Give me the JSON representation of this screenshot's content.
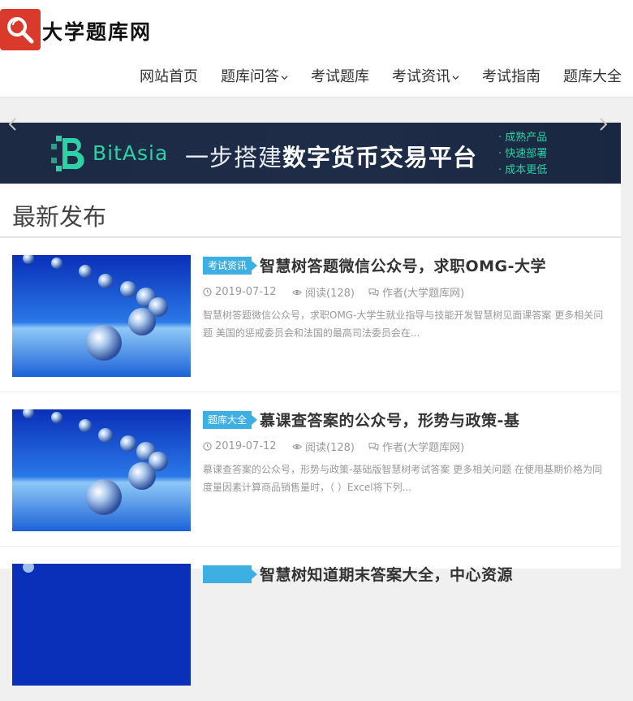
{
  "site": {
    "logo_text": "大学题库网"
  },
  "nav": {
    "items": [
      {
        "label": "网站首页",
        "has_dropdown": false
      },
      {
        "label": "题库问答",
        "has_dropdown": true
      },
      {
        "label": "考试题库",
        "has_dropdown": false
      },
      {
        "label": "考试资讯",
        "has_dropdown": true
      },
      {
        "label": "考试指南",
        "has_dropdown": false
      },
      {
        "label": "题库大全",
        "has_dropdown": false
      }
    ]
  },
  "banner": {
    "brand": "BitAsia",
    "slogan_prefix": "一步搭建",
    "slogan_bold": "数字货币交易平台",
    "points": [
      "成熟产品",
      "快速部署",
      "成本更低"
    ]
  },
  "section": {
    "title": "最新发布"
  },
  "posts": [
    {
      "category": "考试资讯",
      "title": "智慧树答题微信公众号，求职OMG-大学",
      "date": "2019-07-12",
      "views": "阅读(128)",
      "author": "作者(大学题库网)",
      "excerpt": "智慧树答题微信公众号，求职OMG-大学生就业指导与技能开发智慧树见面课答案 更多相关问题 美国的惩戒委员会和法国的最高司法委员会在..."
    },
    {
      "category": "题库大全",
      "title": "慕课查答案的公众号，形势与政策-基",
      "date": "2019-07-12",
      "views": "阅读(128)",
      "author": "作者(大学题库网)",
      "excerpt": "慕课查答案的公众号，形势与政策-基础版智慧树考试答案 更多相关问题 在使用基期价格为同度量因素计算商品销售量时，（ ）Excel将下列..."
    },
    {
      "category": "",
      "title": "智慧树知道期末答案大全，中心资源",
      "date": "",
      "views": "",
      "author": "",
      "excerpt": ""
    }
  ],
  "colors": {
    "accent": "#3dafe3",
    "logo_red": "#d93a2b",
    "banner_bg": "#1c2a44",
    "banner_green": "#2ed1a6"
  }
}
